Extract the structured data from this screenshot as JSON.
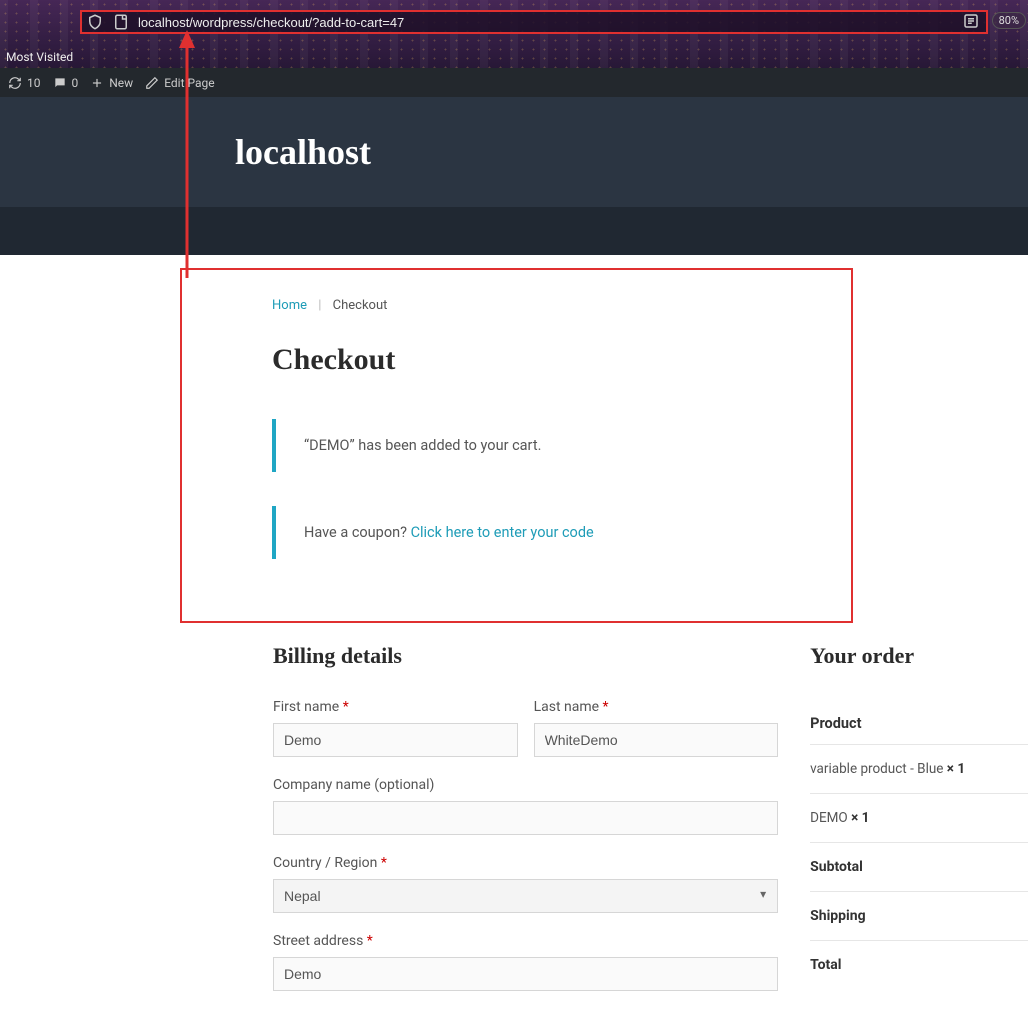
{
  "browser": {
    "url": "localhost/wordpress/checkout/?add-to-cart=47",
    "zoom": "80%",
    "most_visited": "Most Visited"
  },
  "admin_bar": {
    "updates": "10",
    "comments": "0",
    "new_label": "New",
    "edit_label": "Edit Page"
  },
  "site": {
    "title": "localhost"
  },
  "breadcrumb": {
    "home": "Home",
    "current": "Checkout"
  },
  "page_title": "Checkout",
  "notices": {
    "added_to_cart": "“DEMO” has been added to your cart.",
    "coupon_prompt": "Have a coupon? ",
    "coupon_link": "Click here to enter your code"
  },
  "billing": {
    "heading": "Billing details",
    "first_name_label": "First name ",
    "first_name_value": "Demo",
    "last_name_label": "Last name ",
    "last_name_value": "WhiteDemo",
    "company_label": "Company name (optional)",
    "company_value": "",
    "country_label": "Country / Region ",
    "country_value": "Nepal",
    "street_label": "Street address ",
    "street_value": "Demo"
  },
  "order": {
    "heading": "Your order",
    "product_header": "Product",
    "items": [
      {
        "name": "variable product - Blue ",
        "qty": "× 1"
      },
      {
        "name": "DEMO ",
        "qty": "× 1"
      }
    ],
    "subtotal_label": "Subtotal",
    "shipping_label": "Shipping",
    "total_label": "Total"
  }
}
